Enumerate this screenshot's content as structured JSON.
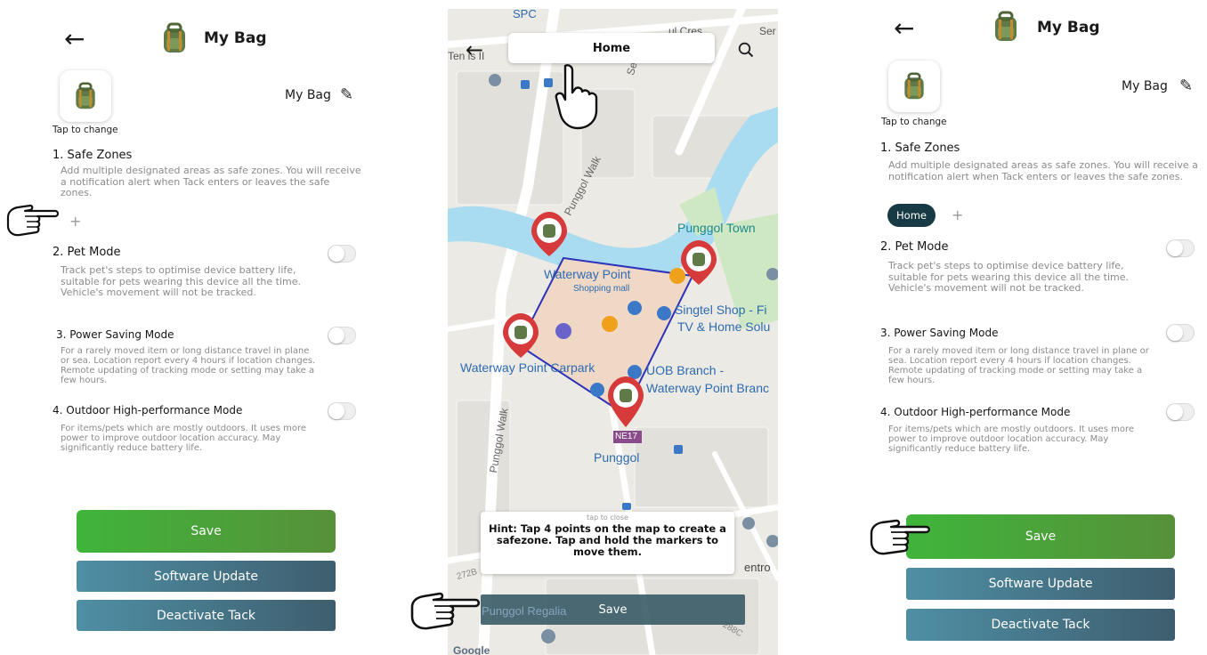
{
  "left_screen": {
    "header": {
      "back_icon": "arrow-left-icon",
      "title": "My Bag"
    },
    "profile": {
      "tap_caption": "Tap to change",
      "bag_name": "My Bag",
      "edit_icon": "pencil-icon"
    },
    "sections": [
      {
        "title": "1. Safe Zones",
        "description": "Add multiple designated areas as safe zones. You will receive a notification alert when Tack enters or leaves the safe zones."
      },
      {
        "title": "2. Pet Mode",
        "description": "Track pet's steps to optimise device battery life, suitable for pets wearing this device all the time. Vehicle's movement will not be tracked."
      },
      {
        "title": "3. Power Saving Mode",
        "description": "For a rarely moved item or long distance travel in plane or sea. Location report every 4 hours if location changes. Remote updating of tracking mode or setting may take a few hours."
      },
      {
        "title": "4. Outdoor High-performance Mode",
        "description": "For items/pets which are mostly outdoors. It uses more power to improve outdoor location accuracy. May significantly reduce battery life."
      }
    ],
    "add_zone_label": "+",
    "buttons": {
      "save": "Save",
      "software_update": "Software Update",
      "deactivate": "Deactivate Tack"
    }
  },
  "map_screen": {
    "search_value": "Home",
    "hint_caption": "tap to close",
    "hint_text": "Hint: Tap 4 points on the map to create a safezone. Tap and hold the markers to move them.",
    "save_label": "Save",
    "labels": {
      "spc": "SPC",
      "cres": "ul Cres",
      "waterway_top": "Waterway",
      "ser": "Ser",
      "ens": "Ten  is II",
      "sentul": "Sentul C",
      "punggol_walk_top": "Punggol Walk",
      "punggol_town": "Punggol Town",
      "waterway_point": "Waterway Point",
      "shopping_mall": "Shopping mall",
      "singtel": "Singtel Shop - Fi",
      "tv_home": "TV & Home Solu",
      "carpark": "Waterway Point Carpark",
      "uob": "UOB Branch -",
      "uob2": "Waterway Point Branc",
      "punggol_walk_bottom": "Punggol Walk",
      "station_code": "NE17",
      "punggol": "Punggol",
      "regalia": "Punggol Regalia",
      "centro": "entro",
      "r272b": "272B",
      "r288c": "288C",
      "google": "Google"
    }
  },
  "right_screen": {
    "header": {
      "back_icon": "arrow-left-icon",
      "title": "My Bag"
    },
    "profile": {
      "tap_caption": "Tap to change",
      "bag_name": "My Bag",
      "edit_icon": "pencil-icon"
    },
    "sections": [
      {
        "title": "1. Safe Zones",
        "description": "Add multiple designated areas as safe zones. You will receive a notification alert when Tack enters or leaves the safe zones."
      },
      {
        "title": "2. Pet Mode",
        "description": "Track pet's steps to optimise device battery life, suitable for pets wearing this device all the time. Vehicle's movement will not be tracked."
      },
      {
        "title": "3. Power Saving Mode",
        "description": "For a rarely moved item or long distance travel in plane or sea. Location report every 4 hours if location changes. Remote updating of tracking mode or setting may take a few hours."
      },
      {
        "title": "4. Outdoor High-performance Mode",
        "description": "For items/pets which are mostly outdoors. It uses more power to improve outdoor location accuracy. May significantly reduce battery life."
      }
    ],
    "zone_chip": "Home",
    "add_zone_label": "+",
    "buttons": {
      "save": "Save",
      "software_update": "Software Update",
      "deactivate": "Deactivate Tack"
    }
  },
  "colors": {
    "save_green": "#48a83a",
    "teal_button": "#467889",
    "route_blue": "#2d33b8",
    "water": "#a9dcf0",
    "marker_red": "#d63a3a"
  }
}
